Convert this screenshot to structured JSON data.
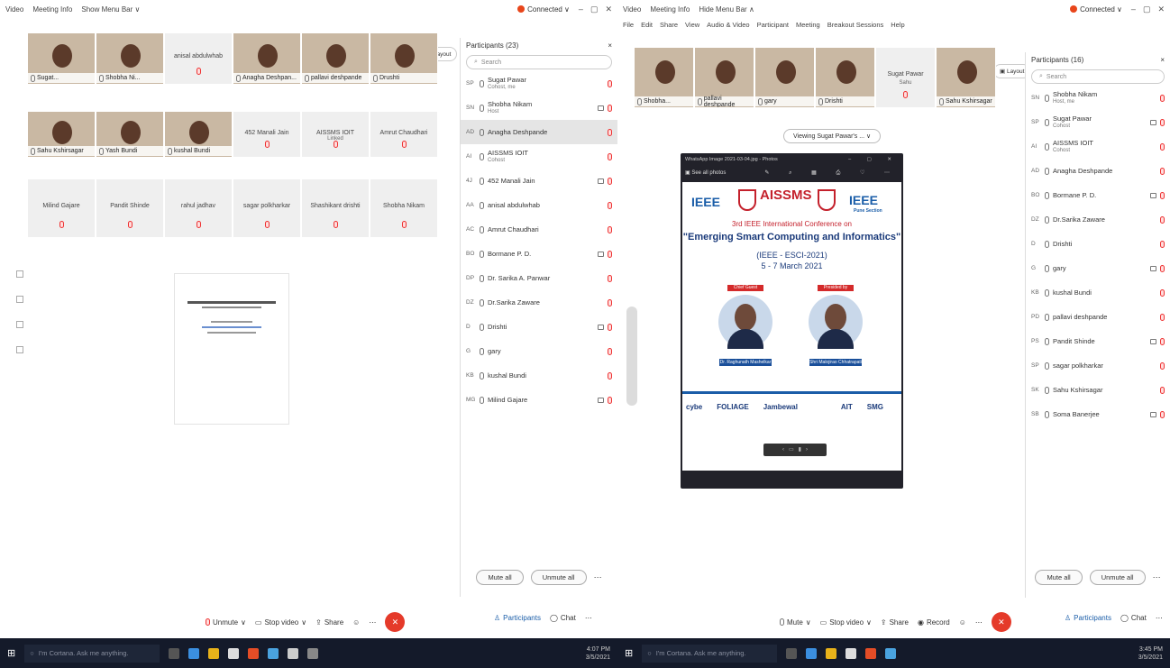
{
  "left": {
    "titlebar": {
      "items": [
        "Video",
        "Meeting Info",
        "Show Menu Bar ∨"
      ],
      "connected": "Connected ∨"
    },
    "tiles_row1": [
      {
        "name": "Sugat..."
      },
      {
        "name": "Shobha Ni..."
      },
      {
        "name": "anisal abdulwhab",
        "center": true
      },
      {
        "name": "Anagha Deshpan..."
      },
      {
        "name": "pallavi deshpande"
      },
      {
        "name": "Drushti"
      }
    ],
    "tiles_row2": [
      {
        "name": "Sahu Kshirsagar"
      },
      {
        "name": "Yash Bundi"
      },
      {
        "name": "kushal Bundi"
      },
      {
        "name": "452 Manali Jain",
        "center": true
      },
      {
        "name": "AISSMS IOIT",
        "sub": "Linked",
        "center": true
      },
      {
        "name": "Amrut Chaudhari",
        "center": true
      }
    ],
    "tiles_row3": [
      "Milind Gajare",
      "Pandit Shinde",
      "rahul jadhav",
      "sagar polkharkar",
      "Shashikant drishti",
      "Shobha Nikam"
    ],
    "layout_label": "Layout",
    "participants": {
      "title": "Participants (23)",
      "search": "Search",
      "rows": [
        {
          "av": "SP",
          "name": "Sugat Pawar",
          "sub": "Cohost, me"
        },
        {
          "av": "SN",
          "name": "Shobha Nikam",
          "sub": "Host"
        },
        {
          "av": "AD",
          "name": "Anagha Deshpande",
          "sel": true
        },
        {
          "av": "AI",
          "name": "AISSMS IOIT",
          "sub": "Cohost"
        },
        {
          "av": "4J",
          "name": "452 Manali Jain"
        },
        {
          "av": "AA",
          "name": "anisal abdulwhab"
        },
        {
          "av": "AC",
          "name": "Amrut Chaudhari"
        },
        {
          "av": "BO",
          "name": "Bormane P. D."
        },
        {
          "av": "DP",
          "name": "Dr. Sarika A. Panwar"
        },
        {
          "av": "DZ",
          "name": "Dr.Sarika Zaware"
        },
        {
          "av": "D",
          "name": "Drishti"
        },
        {
          "av": "G",
          "name": "gary"
        },
        {
          "av": "KB",
          "name": "kushal Bundi"
        },
        {
          "av": "MG",
          "name": "Milind Gajare"
        }
      ],
      "mute_all": "Mute all",
      "unmute_all": "Unmute all"
    },
    "controls": {
      "unmute": "Unmute",
      "stop_video": "Stop video",
      "share": "Share",
      "participants": "Participants",
      "chat": "Chat"
    }
  },
  "right": {
    "titlebar": {
      "items": [
        "Video",
        "Meeting Info",
        "Hide Menu Bar ∧"
      ],
      "connected": "Connected ∨"
    },
    "menu": [
      "File",
      "Edit",
      "Share",
      "View",
      "Audio & Video",
      "Participant",
      "Meeting",
      "Breakout Sessions",
      "Help"
    ],
    "thumbs": [
      {
        "name": "Shobha..."
      },
      {
        "name": "pallavi deshpande"
      },
      {
        "name": "gary"
      },
      {
        "name": "Drishti"
      },
      {
        "name": "Sugat Pawar",
        "sub": "Sahu",
        "center": true
      },
      {
        "name": "Sahu Kshirsagar"
      }
    ],
    "layout_label": "Layout",
    "viewing": "Viewing Sugat Pawar's ... ∨",
    "share_window_title": "WhatsApp Image 2021-03-04.jpg - Photos",
    "see_all_photos": "See all photos",
    "poster": {
      "ieee": "IEEE",
      "aissms": "AISSMS",
      "ieee_pune": "IEEE",
      "pune_section": "Pune Section",
      "conf_line": "3rd IEEE International Conference on",
      "title": "\"Emerging Smart Computing and Informatics\"",
      "code": "(IEEE - ESCI-2021)",
      "dates": "5 - 7 March 2021",
      "tag_left": "Chief Guest",
      "tag_right": "Presided by",
      "speaker_left": "Dr. Raghunath Mashelkar",
      "speaker_right": "Shri Malojirao Chhatrapati",
      "sponsors": [
        "cybe",
        "FOLIAGE",
        "Jambewal",
        "",
        "",
        "AIT",
        "SMG",
        ""
      ]
    },
    "participants": {
      "title": "Participants (16)",
      "search": "Search",
      "rows": [
        {
          "av": "SN",
          "name": "Shobha Nikam",
          "sub": "Host, me"
        },
        {
          "av": "SP",
          "name": "Sugat Pawar",
          "sub": "Cohost"
        },
        {
          "av": "AI",
          "name": "AISSMS IOIT",
          "sub": "Cohost"
        },
        {
          "av": "AD",
          "name": "Anagha Deshpande"
        },
        {
          "av": "BO",
          "name": "Bormane P. D."
        },
        {
          "av": "DZ",
          "name": "Dr.Sarika Zaware"
        },
        {
          "av": "D",
          "name": "Drishti"
        },
        {
          "av": "G",
          "name": "gary"
        },
        {
          "av": "KB",
          "name": "kushal Bundi"
        },
        {
          "av": "PD",
          "name": "pallavi deshpande"
        },
        {
          "av": "PS",
          "name": "Pandit Shinde"
        },
        {
          "av": "SP",
          "name": "sagar polkharkar"
        },
        {
          "av": "SK",
          "name": "Sahu Kshirsagar"
        },
        {
          "av": "SB",
          "name": "Soma Banerjee"
        }
      ],
      "mute_all": "Mute all",
      "unmute_all": "Unmute all"
    },
    "controls": {
      "mute": "Mute",
      "stop_video": "Stop video",
      "share": "Share",
      "record": "Record",
      "participants": "Participants",
      "chat": "Chat"
    }
  },
  "taskbar": {
    "search_left": "I'm Cortana. Ask me anything.",
    "search_right": "I'm Cortana. Ask me anything.",
    "time_left": "4:07 PM",
    "date_left": "3/5/2021",
    "time_right": "3:45 PM",
    "date_right": "3/5/2021"
  },
  "colors": {
    "leave": "#e53a2a",
    "accent": "#1a5da8",
    "taskbar": "#141a2a"
  }
}
